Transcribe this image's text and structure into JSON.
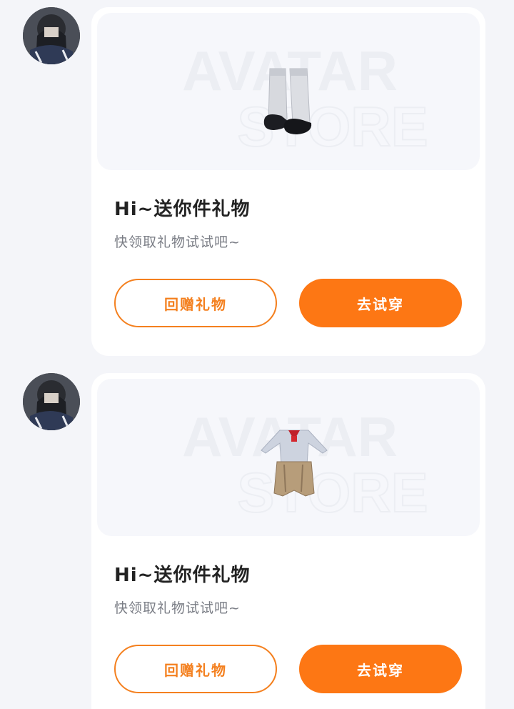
{
  "messages": [
    {
      "title": "Hi~送你件礼物",
      "subtitle": "快领取礼物试试吧~",
      "watermark": [
        "AVATAR",
        "STORE"
      ],
      "return_gift_label": "回赠礼物",
      "try_on_label": "去试穿",
      "item_icon": "boots-icon"
    },
    {
      "title": "Hi~送你件礼物",
      "subtitle": "快领取礼物试试吧~",
      "watermark": [
        "AVATAR",
        "STORE"
      ],
      "return_gift_label": "回赠礼物",
      "try_on_label": "去试穿",
      "item_icon": "outfit-icon"
    }
  ],
  "colors": {
    "accent": "#fd7714",
    "background": "#f4f5f9",
    "card": "#ffffff"
  }
}
